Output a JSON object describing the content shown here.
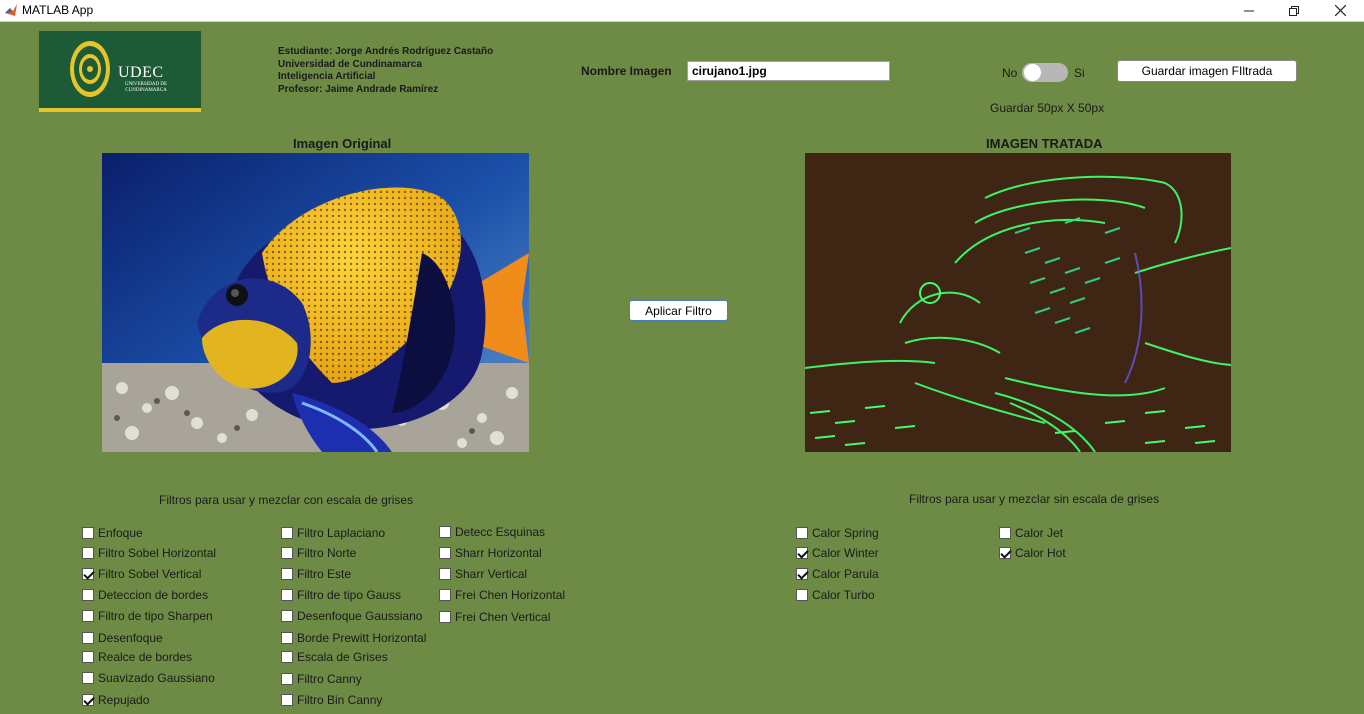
{
  "window": {
    "title": "MATLAB App"
  },
  "logo": {
    "name": "UDEC",
    "subtitle": "UNIVERSIDAD DE CUNDINAMARCA"
  },
  "header_info": [
    "Estudiante: Jorge Andrés Rodríguez Castaño",
    "Universidad de Cundinamarca",
    "Inteligencia Artificial",
    "Profesor: Jaime Andrade Ramírez"
  ],
  "nombre_imagen": {
    "label": "Nombre Imagen",
    "value": "cirujano1.jpg"
  },
  "toggle": {
    "off_label": "No",
    "on_label": "Si",
    "state": "No"
  },
  "guardar": {
    "button": "Guardar imagen FIltrada",
    "size_label": "Guardar 50px X 50px"
  },
  "panels": {
    "original_title": "Imagen Original",
    "tratada_title": "IMAGEN TRATADA"
  },
  "aplicar_button": "Aplicar Filtro",
  "grey_filters": {
    "title": "Filtros para usar y mezclar con escala de grises",
    "columns": [
      [
        {
          "label": "Enfoque",
          "checked": false
        },
        {
          "label": "Filtro Sobel Horizontal",
          "checked": false
        },
        {
          "label": "Filtro Sobel Vertical",
          "checked": true
        },
        {
          "label": "Deteccion de bordes",
          "checked": false
        },
        {
          "label": "Filtro de tipo Sharpen",
          "checked": false
        },
        {
          "label": "Desenfoque",
          "checked": false
        },
        {
          "label": "Realce de bordes",
          "checked": false
        },
        {
          "label": "Suavizado Gaussiano",
          "checked": false
        },
        {
          "label": "Repujado",
          "checked": true
        }
      ],
      [
        {
          "label": "Filtro Laplaciano",
          "checked": false
        },
        {
          "label": "Filtro Norte",
          "checked": false
        },
        {
          "label": "Filtro Este",
          "checked": false
        },
        {
          "label": "Filtro de tipo Gauss",
          "checked": false
        },
        {
          "label": "Desenfoque Gaussiano",
          "checked": false
        },
        {
          "label": "Borde Prewitt Horizontal",
          "checked": false
        },
        {
          "label": "Escala de Grises",
          "checked": false
        },
        {
          "label": "Filtro Canny",
          "checked": false
        },
        {
          "label": "Filtro Bin Canny",
          "checked": false
        }
      ],
      [
        {
          "label": "Detecc Esquinas",
          "checked": false
        },
        {
          "label": "Sharr Horizontal",
          "checked": false
        },
        {
          "label": "Sharr Vertical",
          "checked": false
        },
        {
          "label": "Frei Chen Horizontal",
          "checked": false
        },
        {
          "label": "Frei Chen Vertical",
          "checked": false
        }
      ]
    ]
  },
  "color_filters": {
    "title": "Filtros para usar y mezclar sin escala de grises",
    "columns": [
      [
        {
          "label": "Calor Spring",
          "checked": false
        },
        {
          "label": "Calor Winter",
          "checked": true
        },
        {
          "label": "Calor Parula",
          "checked": true
        },
        {
          "label": "Calor Turbo",
          "checked": false
        }
      ],
      [
        {
          "label": "Calor Jet",
          "checked": false
        },
        {
          "label": "Calor Hot",
          "checked": true
        }
      ]
    ]
  },
  "colors": {
    "background": "#6e8b45",
    "logo_green": "#1d5a36",
    "logo_gold": "#e5c52a",
    "edge_green": "#3cff6a",
    "edge_background": "#3f2514"
  }
}
